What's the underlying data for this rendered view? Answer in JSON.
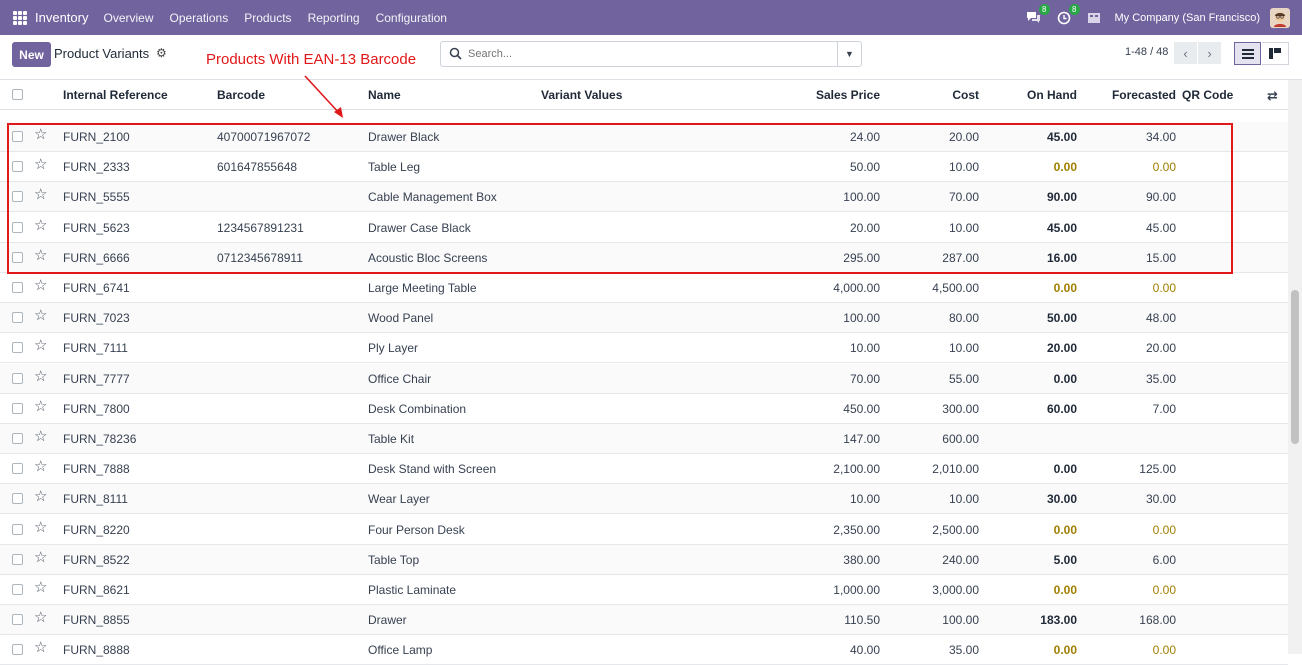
{
  "navbar": {
    "app_name": "Inventory",
    "menu": [
      "Overview",
      "Operations",
      "Products",
      "Reporting",
      "Configuration"
    ],
    "chat_badge": "8",
    "activity_badge": "8",
    "company": "My Company (San Francisco)",
    "accent_color": "#71639e"
  },
  "control": {
    "new_label": "New",
    "title": "Product Variants",
    "search_placeholder": "Search...",
    "pager": "1-48 / 48"
  },
  "annotation": {
    "text": "Products With EAN-13 Barcode",
    "color": "#e0181a"
  },
  "table": {
    "columns": {
      "internal_reference": "Internal Reference",
      "barcode": "Barcode",
      "name": "Name",
      "variant_values": "Variant Values",
      "sales_price": "Sales Price",
      "cost": "Cost",
      "on_hand": "On Hand",
      "forecasted": "Forecasted",
      "qr_code": "QR Code"
    },
    "rows": [
      {
        "ref": "FURN_2100",
        "barcode": "40700071967072",
        "name": "Drawer Black",
        "price": "24.00",
        "cost": "20.00",
        "on_hand": "45.00",
        "forecasted": "34.00",
        "zero": false
      },
      {
        "ref": "FURN_2333",
        "barcode": "601647855648",
        "name": "Table Leg",
        "price": "50.00",
        "cost": "10.00",
        "on_hand": "0.00",
        "forecasted": "0.00",
        "zero": true
      },
      {
        "ref": "FURN_5555",
        "barcode": "",
        "name": "Cable Management Box",
        "price": "100.00",
        "cost": "70.00",
        "on_hand": "90.00",
        "forecasted": "90.00",
        "zero": false
      },
      {
        "ref": "FURN_5623",
        "barcode": "1234567891231",
        "name": "Drawer Case Black",
        "price": "20.00",
        "cost": "10.00",
        "on_hand": "45.00",
        "forecasted": "45.00",
        "zero": false
      },
      {
        "ref": "FURN_6666",
        "barcode": "0712345678911",
        "name": "Acoustic Bloc Screens",
        "price": "295.00",
        "cost": "287.00",
        "on_hand": "16.00",
        "forecasted": "15.00",
        "zero": false
      },
      {
        "ref": "FURN_6741",
        "barcode": "",
        "name": "Large Meeting Table",
        "price": "4,000.00",
        "cost": "4,500.00",
        "on_hand": "0.00",
        "forecasted": "0.00",
        "zero": true
      },
      {
        "ref": "FURN_7023",
        "barcode": "",
        "name": "Wood Panel",
        "price": "100.00",
        "cost": "80.00",
        "on_hand": "50.00",
        "forecasted": "48.00",
        "zero": false
      },
      {
        "ref": "FURN_7111",
        "barcode": "",
        "name": "Ply Layer",
        "price": "10.00",
        "cost": "10.00",
        "on_hand": "20.00",
        "forecasted": "20.00",
        "zero": false
      },
      {
        "ref": "FURN_7777",
        "barcode": "",
        "name": "Office Chair",
        "price": "70.00",
        "cost": "55.00",
        "on_hand": "0.00",
        "forecasted": "35.00",
        "zero": false
      },
      {
        "ref": "FURN_7800",
        "barcode": "",
        "name": "Desk Combination",
        "price": "450.00",
        "cost": "300.00",
        "on_hand": "60.00",
        "forecasted": "7.00",
        "zero": false
      },
      {
        "ref": "FURN_78236",
        "barcode": "",
        "name": "Table Kit",
        "price": "147.00",
        "cost": "600.00",
        "on_hand": "",
        "forecasted": "",
        "zero": false
      },
      {
        "ref": "FURN_7888",
        "barcode": "",
        "name": "Desk Stand with Screen",
        "price": "2,100.00",
        "cost": "2,010.00",
        "on_hand": "0.00",
        "forecasted": "125.00",
        "zero": false
      },
      {
        "ref": "FURN_8111",
        "barcode": "",
        "name": "Wear Layer",
        "price": "10.00",
        "cost": "10.00",
        "on_hand": "30.00",
        "forecasted": "30.00",
        "zero": false
      },
      {
        "ref": "FURN_8220",
        "barcode": "",
        "name": "Four Person Desk",
        "price": "2,350.00",
        "cost": "2,500.00",
        "on_hand": "0.00",
        "forecasted": "0.00",
        "zero": true
      },
      {
        "ref": "FURN_8522",
        "barcode": "",
        "name": "Table Top",
        "price": "380.00",
        "cost": "240.00",
        "on_hand": "5.00",
        "forecasted": "6.00",
        "zero": false
      },
      {
        "ref": "FURN_8621",
        "barcode": "",
        "name": "Plastic Laminate",
        "price": "1,000.00",
        "cost": "3,000.00",
        "on_hand": "0.00",
        "forecasted": "0.00",
        "zero": true
      },
      {
        "ref": "FURN_8855",
        "barcode": "",
        "name": "Drawer",
        "price": "110.50",
        "cost": "100.00",
        "on_hand": "183.00",
        "forecasted": "168.00",
        "zero": false
      },
      {
        "ref": "FURN_8888",
        "barcode": "",
        "name": "Office Lamp",
        "price": "40.00",
        "cost": "35.00",
        "on_hand": "0.00",
        "forecasted": "0.00",
        "zero": true
      }
    ]
  }
}
